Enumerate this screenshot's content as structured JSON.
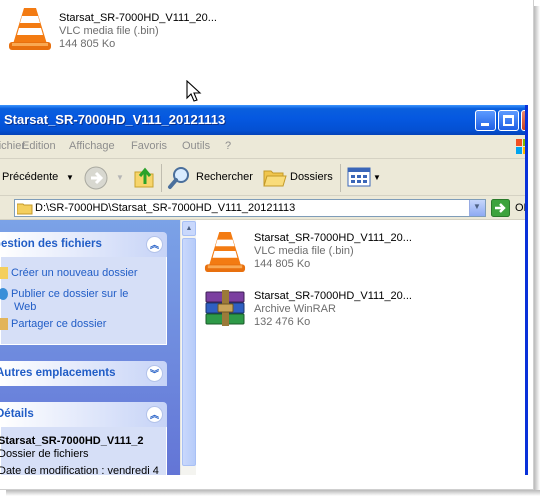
{
  "desktop_file": {
    "name": "Starsat_SR-7000HD_V111_20...",
    "type": "VLC media file (.bin)",
    "size": "144 805 Ko",
    "icon": "vlc-cone-icon"
  },
  "window": {
    "title": "Starsat_SR-7000HD_V111_20121113",
    "menu": [
      "Fichier",
      "Edition",
      "Affichage",
      "Favoris",
      "Outils",
      "?"
    ],
    "toolbar": {
      "back_label": "Précédente",
      "search_label": "Rechercher",
      "folders_label": "Dossiers"
    },
    "address": {
      "path": "D:\\SR-7000HD\\Starsat_SR-7000HD_V111_20121113",
      "go_label": "OK"
    }
  },
  "left_pane": {
    "file_tasks": {
      "header": "Gestion des fichiers",
      "items": [
        "Créer un nouveau dossier",
        "Publier ce dossier sur le",
        "Web",
        "Partager ce dossier"
      ]
    },
    "other_places": {
      "header": "Autres emplacements"
    },
    "details": {
      "header": "Détails",
      "name": "Starsat_SR-7000HD_V111_2",
      "type": "Dossier de fichiers",
      "modified": "Date de modification : vendredi 4"
    }
  },
  "files": [
    {
      "name": "Starsat_SR-7000HD_V111_20...",
      "type": "VLC media file (.bin)",
      "size": "144 805 Ko",
      "icon": "vlc-cone-icon"
    },
    {
      "name": "Starsat_SR-7000HD_V111_20...",
      "type": "Archive WinRAR",
      "size": "132 476 Ko",
      "icon": "winrar-archive-icon"
    }
  ],
  "colors": {
    "titlebar": "#0558e0",
    "taskpane_header_text": "#215dc6",
    "taskpane_bg": "#d6dff7"
  }
}
